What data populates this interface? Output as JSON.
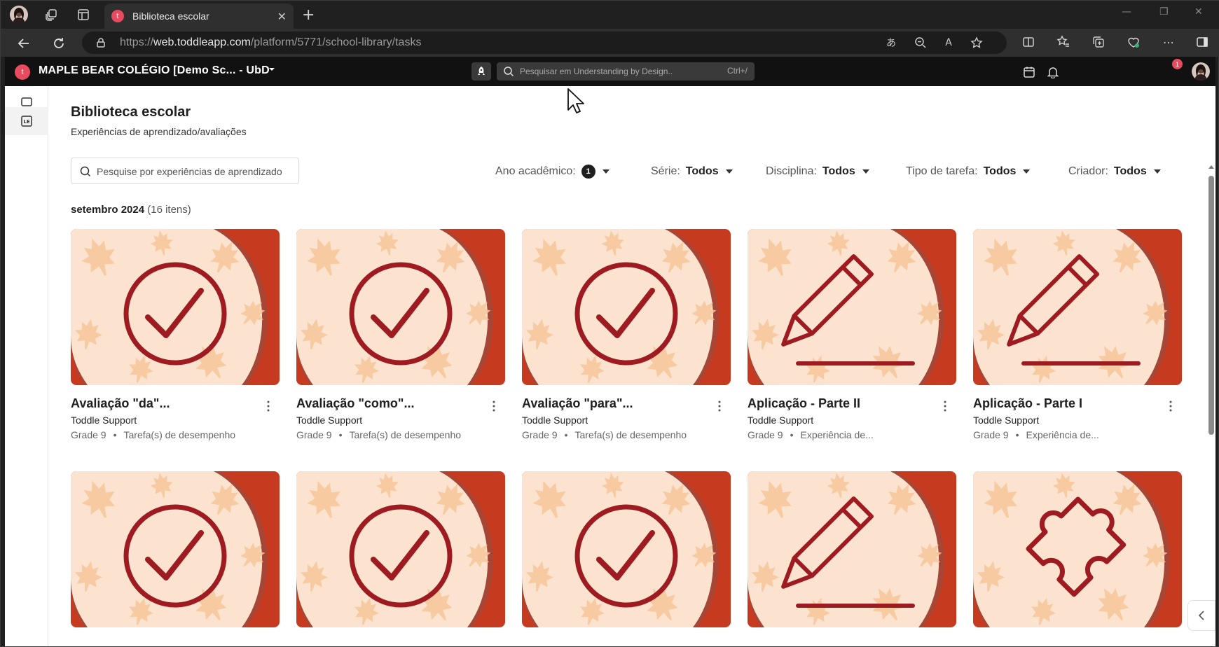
{
  "browser": {
    "tab_title": "Biblioteca escolar",
    "url_prefix": "https://",
    "url_host": "web.toddleapp.com",
    "url_path": "/platform/5771/school-library/tasks"
  },
  "app": {
    "logo_letter": "t",
    "school_name": "MAPLE BEAR COLÉGIO [Demo Sc... - UbD",
    "search_placeholder": "Pesquisar em Understanding by Design..",
    "search_shortcut": "Ctrl+/",
    "notification_count": "1"
  },
  "page": {
    "title": "Biblioteca escolar",
    "subtitle": "Experiências de aprendizado/avaliações",
    "search_placeholder": "Pesquise por experiências de aprendizado",
    "filters": {
      "year_label": "Ano acadêmico:",
      "year_value": "1",
      "grade_label": "Série:",
      "grade_value": "Todos",
      "subject_label": "Disciplina:",
      "subject_value": "Todos",
      "task_label": "Tipo de tarefa:",
      "task_value": "Todos",
      "creator_label": "Criador:",
      "creator_value": "Todos"
    },
    "group_title": "setembro 2024",
    "group_count": "(16 itens)"
  },
  "cards": [
    {
      "title": "Avaliação \"da\"...",
      "author": "Toddle Support",
      "grade": "Grade 9",
      "type": "Tarefa(s) de desempenho",
      "icon": "check-circle"
    },
    {
      "title": "Avaliação \"como\"...",
      "author": "Toddle Support",
      "grade": "Grade 9",
      "type": "Tarefa(s) de desempenho",
      "icon": "check-circle"
    },
    {
      "title": "Avaliação \"para\"...",
      "author": "Toddle Support",
      "grade": "Grade 9",
      "type": "Tarefa(s) de desempenho",
      "icon": "check-circle"
    },
    {
      "title": "Aplicação - Parte II",
      "author": "Toddle Support",
      "grade": "Grade 9",
      "type": "Experiência de...",
      "icon": "pencil"
    },
    {
      "title": "Aplicação - Parte I",
      "author": "Toddle Support",
      "grade": "Grade 9",
      "type": "Experiência de...",
      "icon": "pencil"
    },
    {
      "title": "",
      "author": "",
      "grade": "",
      "type": "",
      "icon": "check-circle"
    },
    {
      "title": "",
      "author": "",
      "grade": "",
      "type": "",
      "icon": "check-circle"
    },
    {
      "title": "",
      "author": "",
      "grade": "",
      "type": "",
      "icon": "check-circle"
    },
    {
      "title": "",
      "author": "",
      "grade": "",
      "type": "",
      "icon": "pencil"
    },
    {
      "title": "",
      "author": "",
      "grade": "",
      "type": "",
      "icon": "puzzle"
    }
  ],
  "colors": {
    "accent": "#9e1b22",
    "thumb_bg": "#fbe3cf",
    "thumb_red": "#c63a20",
    "leaf": "#f6c59a",
    "brand": "#e84a5f"
  }
}
